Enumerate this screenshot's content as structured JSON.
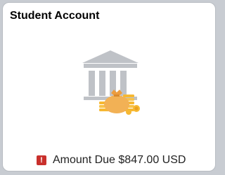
{
  "tile": {
    "title": "Student Account",
    "illustration_icon": "bank-money-bag-icon",
    "status": {
      "icon": "alert-icon",
      "icon_glyph": "!",
      "icon_color": "#c9302c",
      "label": "Amount Due",
      "amount": "$847.00 USD"
    }
  },
  "colors": {
    "building": "#bfc2c7",
    "coins": "#f6b832",
    "bag": "#f2b155"
  }
}
